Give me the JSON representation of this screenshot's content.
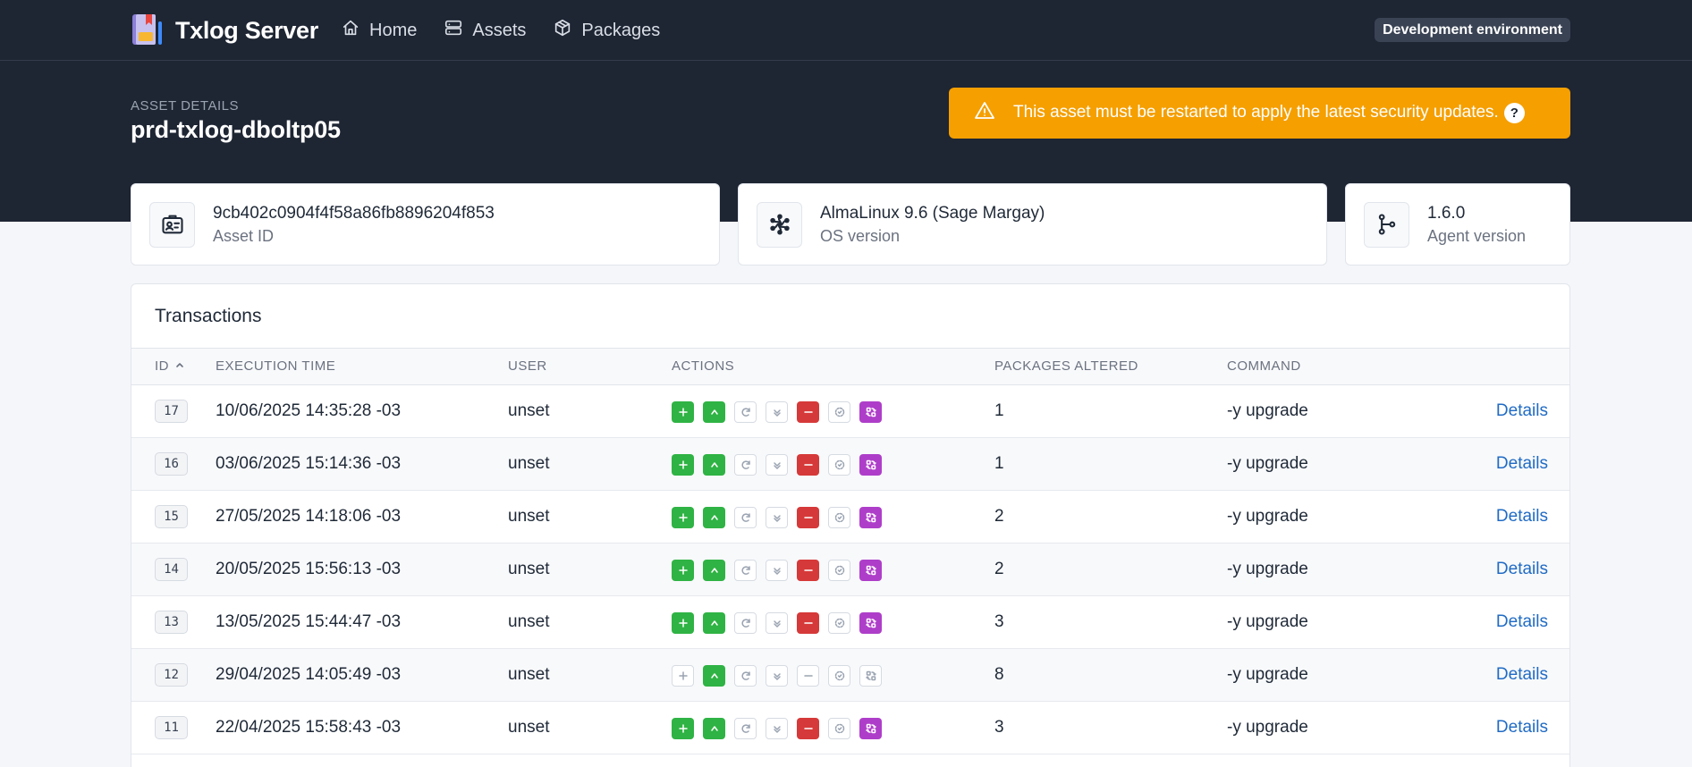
{
  "app": {
    "name": "Txlog Server",
    "env_badge": "Development environment"
  },
  "nav": [
    {
      "label": "Home",
      "icon": "home-icon"
    },
    {
      "label": "Assets",
      "icon": "server-icon"
    },
    {
      "label": "Packages",
      "icon": "package-icon"
    }
  ],
  "page": {
    "eyebrow": "ASSET DETAILS",
    "title": "prd-txlog-dboltp05"
  },
  "alert": {
    "message": "This asset must be restarted to apply the latest security updates.",
    "help": "?"
  },
  "cards": [
    {
      "value": "9cb402c0904f4f58a86fb8896204f853",
      "label": "Asset ID",
      "icon": "id-badge-icon"
    },
    {
      "value": "AlmaLinux 9.6 (Sage Margay)",
      "label": "OS version",
      "icon": "almalinux-logo-icon"
    },
    {
      "value": "1.6.0",
      "label": "Agent version",
      "icon": "git-branch-icon"
    }
  ],
  "table": {
    "title": "Transactions",
    "headers": {
      "id": "ID",
      "time": "EXECUTION TIME",
      "user": "USER",
      "actions": "ACTIONS",
      "packages": "PACKAGES ALTERED",
      "command": "COMMAND"
    },
    "sort_icon": "chevron-up-icon",
    "details_label": "Details",
    "action_types": [
      {
        "name": "install",
        "icon": "plus-icon",
        "color": "#2fb344"
      },
      {
        "name": "upgrade",
        "icon": "arrow-up-icon",
        "color": "#2fb344"
      },
      {
        "name": "reinstall",
        "icon": "refresh-icon",
        "color": "#ffffff"
      },
      {
        "name": "downgrade",
        "icon": "arrow-down-icon",
        "color": "#ffffff"
      },
      {
        "name": "remove",
        "icon": "minus-icon",
        "color": "#d63939"
      },
      {
        "name": "reason-change",
        "icon": "dashed-circle-icon",
        "color": "#ffffff"
      },
      {
        "name": "obsolete",
        "icon": "replace-icon",
        "color": "#ae3ec9"
      }
    ],
    "rows": [
      {
        "id": "17",
        "time": "10/06/2025 14:35:28 -03",
        "user": "unset",
        "packages": "1",
        "command": "-y upgrade",
        "active": [
          true,
          true,
          false,
          false,
          true,
          false,
          true
        ]
      },
      {
        "id": "16",
        "time": "03/06/2025 15:14:36 -03",
        "user": "unset",
        "packages": "1",
        "command": "-y upgrade",
        "active": [
          true,
          true,
          false,
          false,
          true,
          false,
          true
        ]
      },
      {
        "id": "15",
        "time": "27/05/2025 14:18:06 -03",
        "user": "unset",
        "packages": "2",
        "command": "-y upgrade",
        "active": [
          true,
          true,
          false,
          false,
          true,
          false,
          true
        ]
      },
      {
        "id": "14",
        "time": "20/05/2025 15:56:13 -03",
        "user": "unset",
        "packages": "2",
        "command": "-y upgrade",
        "active": [
          true,
          true,
          false,
          false,
          true,
          false,
          true
        ]
      },
      {
        "id": "13",
        "time": "13/05/2025 15:44:47 -03",
        "user": "unset",
        "packages": "3",
        "command": "-y upgrade",
        "active": [
          true,
          true,
          false,
          false,
          true,
          false,
          true
        ]
      },
      {
        "id": "12",
        "time": "29/04/2025 14:05:49 -03",
        "user": "unset",
        "packages": "8",
        "command": "-y upgrade",
        "active": [
          false,
          true,
          false,
          false,
          false,
          false,
          false
        ]
      },
      {
        "id": "11",
        "time": "22/04/2025 15:58:43 -03",
        "user": "unset",
        "packages": "3",
        "command": "-y upgrade",
        "active": [
          true,
          true,
          false,
          false,
          true,
          false,
          true
        ]
      }
    ]
  }
}
